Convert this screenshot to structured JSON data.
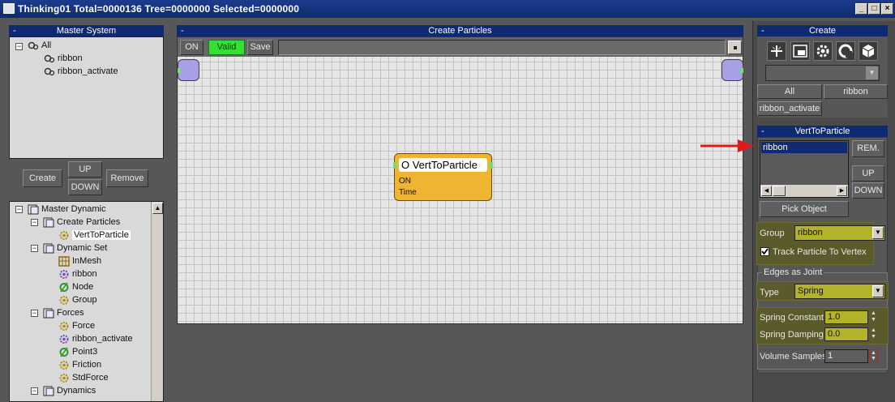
{
  "window": {
    "title": "Thinking01  Total=0000136  Tree=0000000  Selected=0000000",
    "min": "_",
    "max": "□",
    "close": "×"
  },
  "master_system": {
    "header": "Master System",
    "collapse": "-",
    "root": "All",
    "items": [
      "ribbon",
      "ribbon_activate"
    ]
  },
  "system_buttons": {
    "create": "Create",
    "up": "UP",
    "down": "DOWN",
    "remove": "Remove"
  },
  "dynamic_tree": {
    "root": "Master Dynamic",
    "groups": [
      {
        "label": "Create Particles",
        "children": [
          "VertToParticle"
        ]
      },
      {
        "label": "Dynamic Set",
        "children": [
          "InMesh",
          "ribbon",
          "Node",
          "Group"
        ]
      },
      {
        "label": "Forces",
        "children": [
          "Force",
          "ribbon_activate",
          "Point3",
          "Friction",
          "StdForce"
        ]
      },
      {
        "label": "Dynamics",
        "children": []
      }
    ]
  },
  "canvas": {
    "header": "Create Particles",
    "collapse": "-",
    "on_label": "ON",
    "valid_label": "Valid",
    "save_label": "Save",
    "node": {
      "title": "O VertToParticle",
      "ports": [
        "ON",
        "Time"
      ]
    }
  },
  "create_panel": {
    "header": "Create",
    "collapse": "-",
    "tabs": [
      "All",
      "ribbon",
      "ribbon_activate"
    ]
  },
  "vert_panel": {
    "header": "VertToParticle",
    "collapse": "-",
    "list_items": [
      "ribbon"
    ],
    "rem": "REM.",
    "up": "UP",
    "down": "DOWN",
    "pick_object": "Pick Object",
    "group_label": "Group",
    "group_value": "ribbon",
    "track_label": "Track Particle To Vertex",
    "track_checked": true,
    "edges_label": "Edges as Joint",
    "type_label": "Type",
    "type_value": "Spring",
    "spring_constant_label": "Spring Constant",
    "spring_constant_value": "1.0",
    "spring_damping_label": "Spring Damping",
    "spring_damping_value": "0.0",
    "volume_samples_label": "Volume Samples",
    "volume_samples_value": "1"
  },
  "colors": {
    "title_bar": "#0e2a72",
    "node_fill": "#f0b433",
    "valid_green": "#33e033",
    "highlight_yellow": "#b3b32a",
    "arrow_red": "#e01a1a"
  }
}
